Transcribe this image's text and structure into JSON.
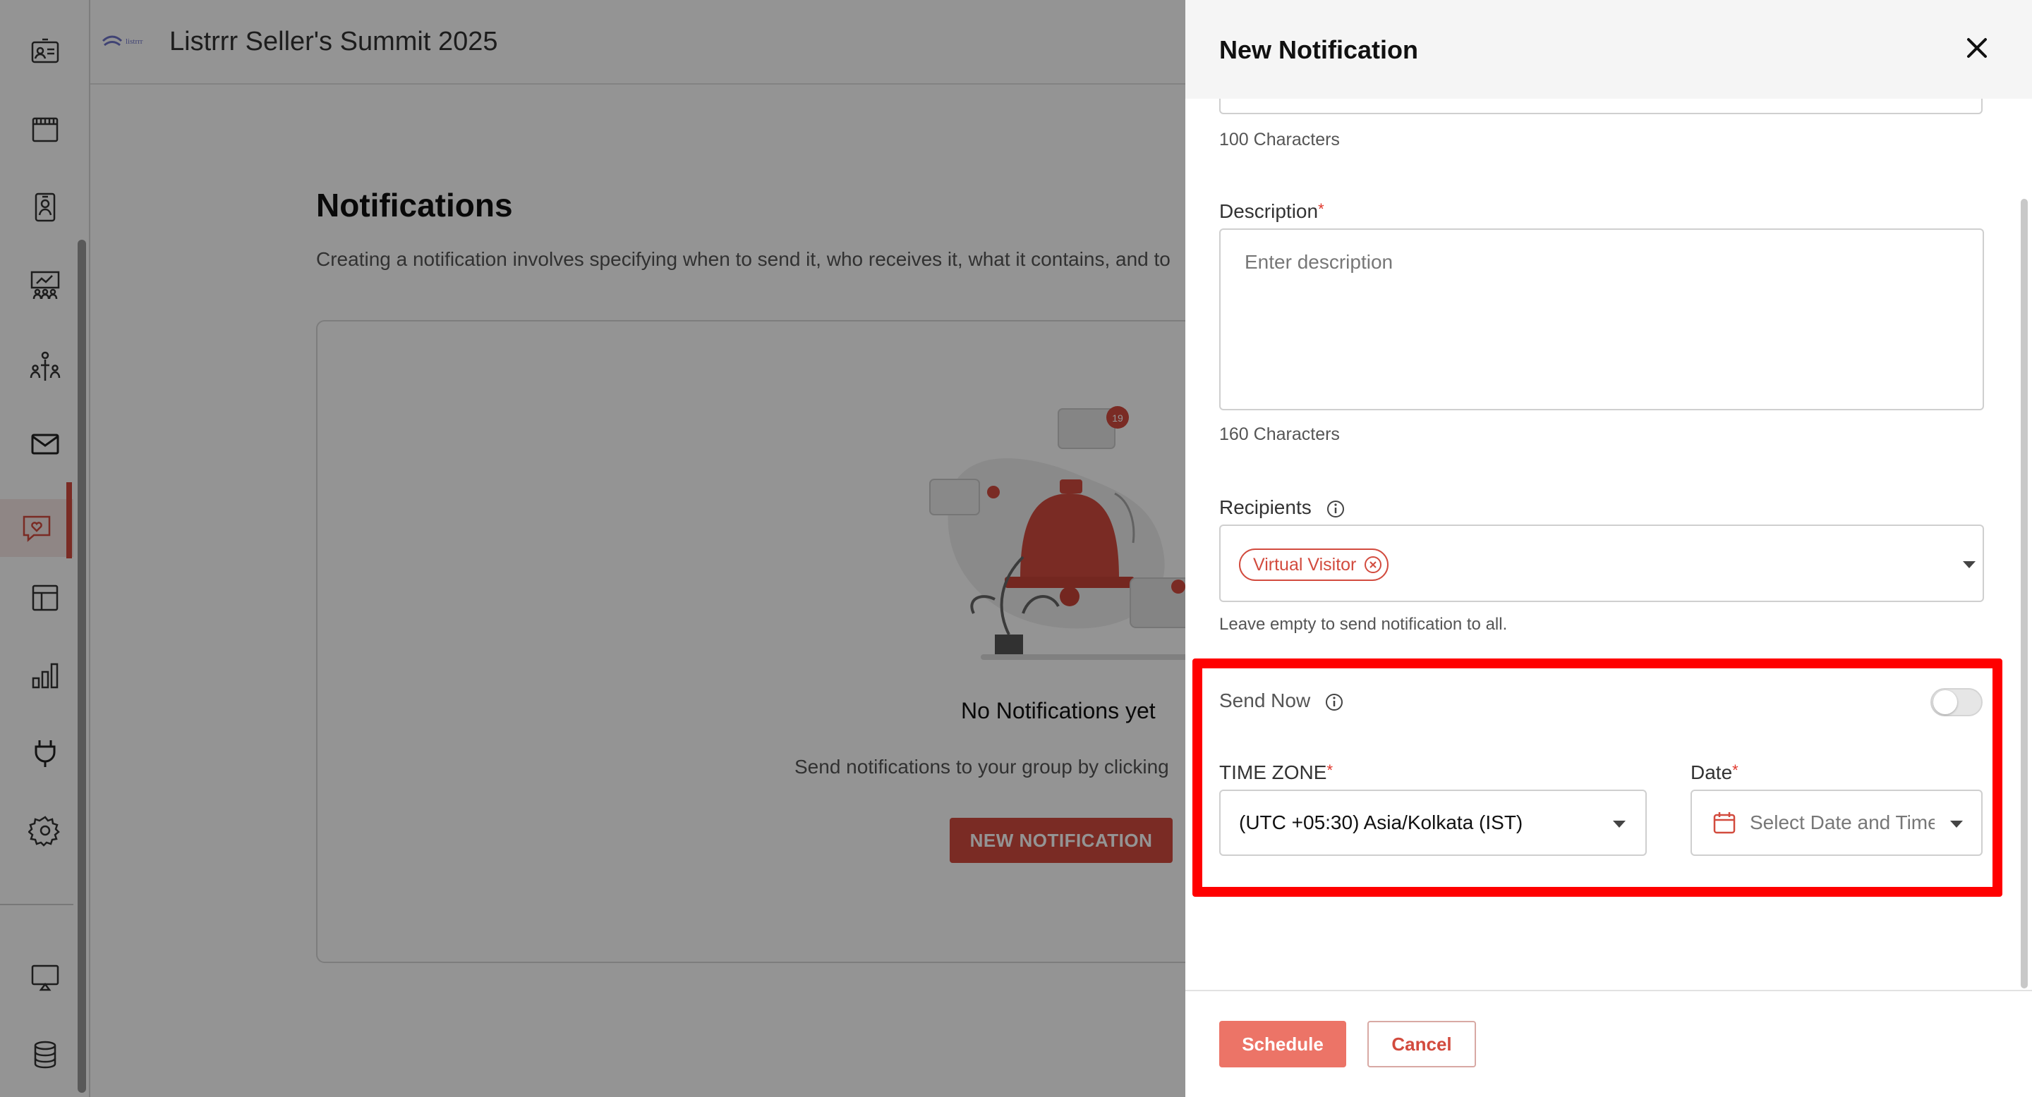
{
  "header": {
    "logo_text": "listrrr",
    "event_title": "Listrrr Seller's Summit 2025"
  },
  "sidebar": {
    "items": [
      {
        "icon": "badge-icon"
      },
      {
        "icon": "calendar-grid-icon"
      },
      {
        "icon": "id-card-icon"
      },
      {
        "icon": "presentation-icon"
      },
      {
        "icon": "people-network-icon"
      },
      {
        "icon": "mail-icon"
      },
      {
        "icon": "chat-heart-icon",
        "active": true
      },
      {
        "icon": "layout-icon"
      },
      {
        "icon": "bar-chart-icon"
      },
      {
        "icon": "plug-icon"
      },
      {
        "icon": "gear-icon"
      },
      {
        "icon": "cast-icon"
      },
      {
        "icon": "database-icon"
      }
    ]
  },
  "main": {
    "title": "Notifications",
    "description": "Creating a notification involves specifying when to send it, who receives it, what it contains, and to",
    "empty": {
      "title": "No Notifications yet",
      "subtitle": "Send notifications to your group by clicking",
      "button_label": "NEW NOTIFICATION",
      "badge_count": "19"
    }
  },
  "drawer": {
    "title": "New Notification",
    "title_field": {
      "counter": "100 Characters"
    },
    "description_field": {
      "label": "Description",
      "required_mark": "*",
      "placeholder": "Enter  description",
      "counter": "160 Characters"
    },
    "recipients": {
      "label": "Recipients",
      "chips": [
        "Virtual Visitor"
      ],
      "helper": "Leave empty to send notification to all."
    },
    "send_now": {
      "label": "Send Now",
      "enabled": false
    },
    "time_zone": {
      "label": "TIME ZONE",
      "required_mark": "*",
      "value": "(UTC +05:30) Asia/Kolkata (IST)"
    },
    "date": {
      "label": "Date",
      "required_mark": "*",
      "placeholder": "Select Date and Time"
    },
    "footer": {
      "schedule_label": "Schedule",
      "cancel_label": "Cancel"
    }
  },
  "colors": {
    "accent": "#d24b3e",
    "accent_light": "#ec7467",
    "highlight": "#ff0000"
  }
}
